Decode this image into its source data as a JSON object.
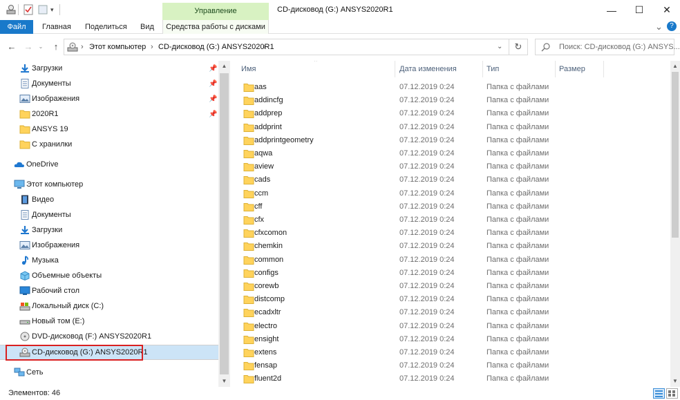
{
  "window": {
    "title": "CD-дисковод (G:) ANSYS2020R1",
    "manage_label": "Управление",
    "minimize": "—",
    "maximize": "☐",
    "close": "✕"
  },
  "ribbon": {
    "tabs": [
      "Файл",
      "Главная",
      "Поделиться",
      "Вид",
      "Средства работы с дисками"
    ],
    "collapse": "⌄",
    "help": "?"
  },
  "address": {
    "segments": [
      "Этот компьютер",
      "CD-дисковод (G:) ANSYS2020R1"
    ],
    "separator": "›",
    "search_placeholder": "Поиск: CD-дисковод (G:) ANSYS..."
  },
  "sidebar": {
    "quick_access": [
      {
        "label": "Загрузки",
        "icon": "download-icon",
        "pinned": true
      },
      {
        "label": "Документы",
        "icon": "document-icon",
        "pinned": true
      },
      {
        "label": "Изображения",
        "icon": "pictures-icon",
        "pinned": true
      },
      {
        "label": "2020R1",
        "icon": "folder-icon",
        "pinned": true
      },
      {
        "label": "ANSYS 19",
        "icon": "folder-icon",
        "pinned": false
      },
      {
        "label": "С хранилки",
        "icon": "folder-icon",
        "pinned": false
      }
    ],
    "onedrive": "OneDrive",
    "this_pc": "Этот компьютер",
    "pc_items": [
      {
        "label": "Видео",
        "icon": "video-icon"
      },
      {
        "label": "Документы",
        "icon": "document-icon"
      },
      {
        "label": "Загрузки",
        "icon": "download-icon"
      },
      {
        "label": "Изображения",
        "icon": "pictures-icon"
      },
      {
        "label": "Музыка",
        "icon": "music-icon"
      },
      {
        "label": "Объемные объекты",
        "icon": "3d-objects-icon"
      },
      {
        "label": "Рабочий стол",
        "icon": "desktop-icon"
      },
      {
        "label": "Локальный диск (C:)",
        "icon": "local-disk-icon"
      },
      {
        "label": "Новый том (E:)",
        "icon": "drive-icon"
      },
      {
        "label": "DVD-дисковод (F:) ANSYS2020R1",
        "icon": "dvd-drive-icon"
      },
      {
        "label": "CD-дисковод (G:) ANSYS2020R1",
        "icon": "cd-drive-icon"
      }
    ],
    "network": "Сеть"
  },
  "columns": {
    "name": "Имя",
    "date": "Дата изменения",
    "type": "Тип",
    "size": "Размер"
  },
  "files": [
    {
      "name": "aas",
      "date": "07.12.2019 0:24",
      "type": "Папка с файлами"
    },
    {
      "name": "addincfg",
      "date": "07.12.2019 0:24",
      "type": "Папка с файлами"
    },
    {
      "name": "addprep",
      "date": "07.12.2019 0:24",
      "type": "Папка с файлами"
    },
    {
      "name": "addprint",
      "date": "07.12.2019 0:24",
      "type": "Папка с файлами"
    },
    {
      "name": "addprintgeometry",
      "date": "07.12.2019 0:24",
      "type": "Папка с файлами"
    },
    {
      "name": "aqwa",
      "date": "07.12.2019 0:24",
      "type": "Папка с файлами"
    },
    {
      "name": "aview",
      "date": "07.12.2019 0:24",
      "type": "Папка с файлами"
    },
    {
      "name": "cads",
      "date": "07.12.2019 0:24",
      "type": "Папка с файлами"
    },
    {
      "name": "ccm",
      "date": "07.12.2019 0:24",
      "type": "Папка с файлами"
    },
    {
      "name": "cff",
      "date": "07.12.2019 0:24",
      "type": "Папка с файлами"
    },
    {
      "name": "cfx",
      "date": "07.12.2019 0:24",
      "type": "Папка с файлами"
    },
    {
      "name": "cfxcomon",
      "date": "07.12.2019 0:24",
      "type": "Папка с файлами"
    },
    {
      "name": "chemkin",
      "date": "07.12.2019 0:24",
      "type": "Папка с файлами"
    },
    {
      "name": "common",
      "date": "07.12.2019 0:24",
      "type": "Папка с файлами"
    },
    {
      "name": "configs",
      "date": "07.12.2019 0:24",
      "type": "Папка с файлами"
    },
    {
      "name": "corewb",
      "date": "07.12.2019 0:24",
      "type": "Папка с файлами"
    },
    {
      "name": "distcomp",
      "date": "07.12.2019 0:24",
      "type": "Папка с файлами"
    },
    {
      "name": "ecadxltr",
      "date": "07.12.2019 0:24",
      "type": "Папка с файлами"
    },
    {
      "name": "electro",
      "date": "07.12.2019 0:24",
      "type": "Папка с файлами"
    },
    {
      "name": "ensight",
      "date": "07.12.2019 0:24",
      "type": "Папка с файлами"
    },
    {
      "name": "extens",
      "date": "07.12.2019 0:24",
      "type": "Папка с файлами"
    },
    {
      "name": "fensap",
      "date": "07.12.2019 0:24",
      "type": "Папка с файлами"
    },
    {
      "name": "fluent2d",
      "date": "07.12.2019 0:24",
      "type": "Папка с файлами"
    }
  ],
  "status": {
    "item_count": "Элементов: 46"
  },
  "colors": {
    "accent": "#1979ca",
    "manage_tab": "#d8f2c2",
    "folder": "#ffd35c",
    "selection": "#cce4f7",
    "highlight": "#d92020"
  }
}
